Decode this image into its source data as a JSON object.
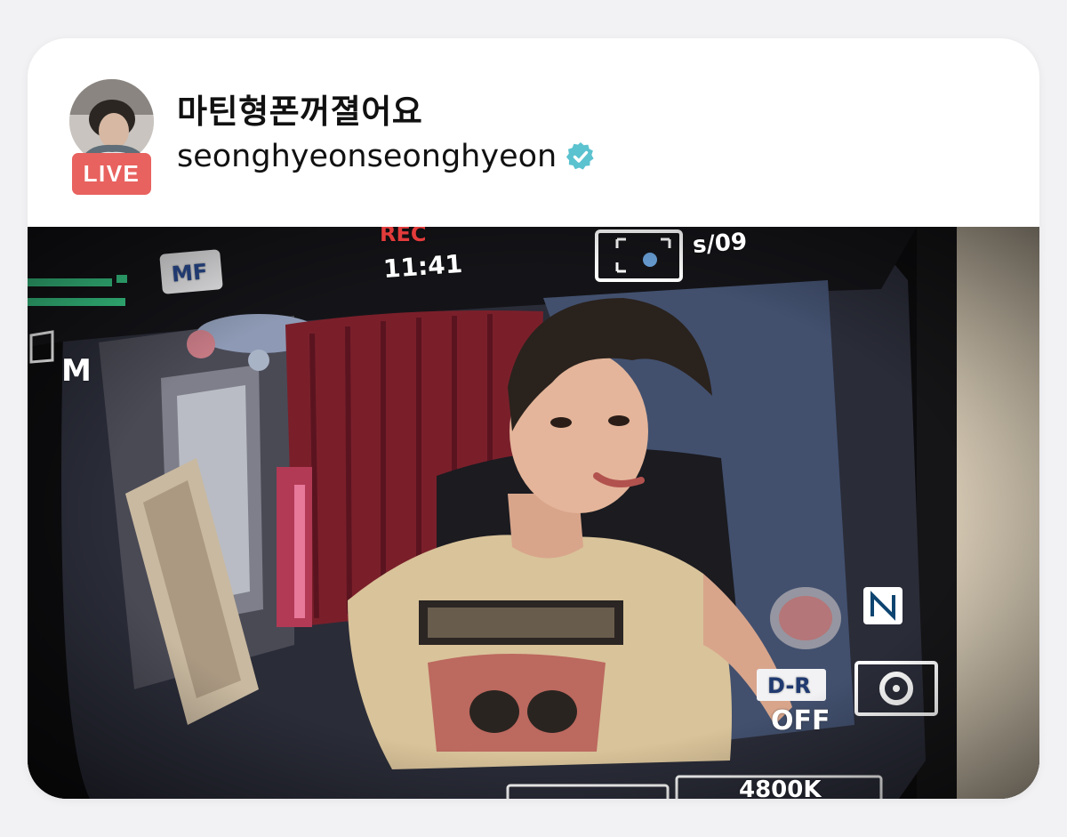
{
  "post": {
    "title": "마틴형폰꺼졀어요",
    "username": "seonghyeonseonghyeon",
    "live_label": "LIVE",
    "verified_icon": "verified-badge-icon",
    "colors": {
      "live_badge": "#e8625f",
      "verified": "#5bc2cf",
      "card_bg": "#ffffff",
      "page_bg": "#f2f2f4"
    }
  },
  "camera_overlay": {
    "rec_label": "REC",
    "time": "11:41",
    "focus_mode": "MF",
    "mode": "M",
    "shutter": "s/09",
    "dr_label": "D-R",
    "dr_value": "OFF",
    "white_balance": "4800K"
  }
}
